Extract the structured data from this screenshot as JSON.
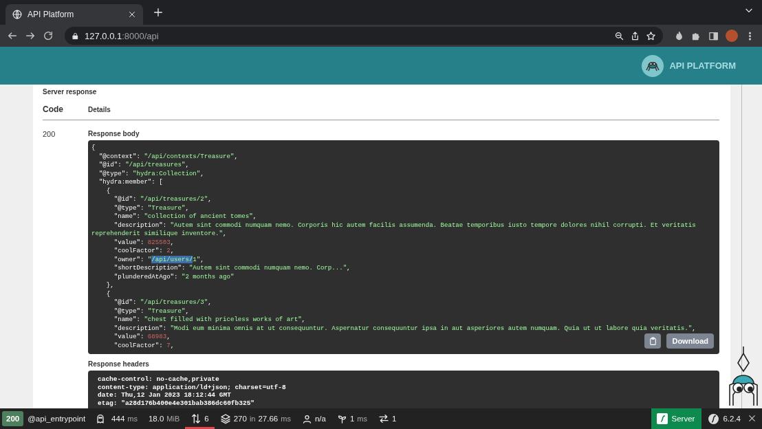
{
  "browser": {
    "tab_title": "API Platform",
    "url_host": "127.0.0.1",
    "url_path": ":8000/api"
  },
  "header": {
    "logo_text": "API PLATFORM"
  },
  "server_response": {
    "title": "Server response",
    "columns": [
      "Code",
      "Details"
    ],
    "code": "200",
    "body_label": "Response body",
    "body_lines": [
      [
        {
          "kind": "plain",
          "text": "{"
        }
      ],
      [
        {
          "kind": "key",
          "text": "  \"@context\": "
        },
        {
          "kind": "str",
          "text": "\"/api/contexts/Treasure\""
        },
        {
          "kind": "plain",
          "text": ","
        }
      ],
      [
        {
          "kind": "key",
          "text": "  \"@id\": "
        },
        {
          "kind": "str",
          "text": "\"/api/treasures\""
        },
        {
          "kind": "plain",
          "text": ","
        }
      ],
      [
        {
          "kind": "key",
          "text": "  \"@type\": "
        },
        {
          "kind": "str",
          "text": "\"hydra:Collection\""
        },
        {
          "kind": "plain",
          "text": ","
        }
      ],
      [
        {
          "kind": "key",
          "text": "  \"hydra:member\": ["
        }
      ],
      [
        {
          "kind": "plain",
          "text": "    {"
        }
      ],
      [
        {
          "kind": "key",
          "text": "      \"@id\": "
        },
        {
          "kind": "str",
          "text": "\"/api/treasures/2\""
        },
        {
          "kind": "plain",
          "text": ","
        }
      ],
      [
        {
          "kind": "key",
          "text": "      \"@type\": "
        },
        {
          "kind": "str",
          "text": "\"Treasure\""
        },
        {
          "kind": "plain",
          "text": ","
        }
      ],
      [
        {
          "kind": "key",
          "text": "      \"name\": "
        },
        {
          "kind": "str",
          "text": "\"collection of ancient tomes\""
        },
        {
          "kind": "plain",
          "text": ","
        }
      ],
      [
        {
          "kind": "key",
          "text": "      \"description\": "
        },
        {
          "kind": "str",
          "text": "\"Autem sint commodi numquam nemo. Corporis hic autem facilis assumenda. Beatae temporibus iusto tempore dolores nihil corrupti. Et veritatis"
        }
      ],
      [
        {
          "kind": "str",
          "text": "reprehenderit similique inventore.\""
        },
        {
          "kind": "plain",
          "text": ","
        }
      ],
      [
        {
          "kind": "key",
          "text": "      \"value\": "
        },
        {
          "kind": "num",
          "text": "825503"
        },
        {
          "kind": "plain",
          "text": ","
        }
      ],
      [
        {
          "kind": "key",
          "text": "      \"coolFactor\": "
        },
        {
          "kind": "num",
          "text": "2"
        },
        {
          "kind": "plain",
          "text": ","
        }
      ],
      [
        {
          "kind": "key",
          "text": "      \"owner\": "
        },
        {
          "kind": "str",
          "text": "\""
        },
        {
          "kind": "selected",
          "text": "/api/users/"
        },
        {
          "kind": "str",
          "text": "1\""
        },
        {
          "kind": "plain",
          "text": ","
        }
      ],
      [
        {
          "kind": "key",
          "text": "      \"shortDescription\": "
        },
        {
          "kind": "str",
          "text": "\"Autem sint commodi numquam nemo. Corp...\""
        },
        {
          "kind": "plain",
          "text": ","
        }
      ],
      [
        {
          "kind": "key",
          "text": "      \"plunderedAtAgo\": "
        },
        {
          "kind": "str",
          "text": "\"2 months ago\""
        }
      ],
      [
        {
          "kind": "plain",
          "text": "    },"
        }
      ],
      [
        {
          "kind": "plain",
          "text": "    {"
        }
      ],
      [
        {
          "kind": "key",
          "text": "      \"@id\": "
        },
        {
          "kind": "str",
          "text": "\"/api/treasures/3\""
        },
        {
          "kind": "plain",
          "text": ","
        }
      ],
      [
        {
          "kind": "key",
          "text": "      \"@type\": "
        },
        {
          "kind": "str",
          "text": "\"Treasure\""
        },
        {
          "kind": "plain",
          "text": ","
        }
      ],
      [
        {
          "kind": "key",
          "text": "      \"name\": "
        },
        {
          "kind": "str",
          "text": "\"chest filled with priceless works of art\""
        },
        {
          "kind": "plain",
          "text": ","
        }
      ],
      [
        {
          "kind": "key",
          "text": "      \"description\": "
        },
        {
          "kind": "str",
          "text": "\"Modi eum minima omnis at ut consequuntur. Aspernatur consequuntur ipsa in aut asperiores autem numquam. Quia ut ut labore quia veritatis.\""
        },
        {
          "kind": "plain",
          "text": ","
        }
      ],
      [
        {
          "kind": "key",
          "text": "      \"value\": "
        },
        {
          "kind": "num",
          "text": "68983"
        },
        {
          "kind": "plain",
          "text": ","
        }
      ],
      [
        {
          "kind": "key",
          "text": "      \"coolFactor\": "
        },
        {
          "kind": "num",
          "text": "7"
        },
        {
          "kind": "plain",
          "text": ","
        }
      ]
    ],
    "download": "Download",
    "headers_label": "Response headers",
    "header_lines": [
      "cache-control: no-cache,private",
      "content-type: application/ld+json; charset=utf-8",
      "date: Thu,12 Jan 2023 18:12:44 GMT",
      "etag: \"a28d176b400e4e301bab386dc60fb325\""
    ]
  },
  "debug_toolbar": {
    "status": "200",
    "route": "@api_entrypoint",
    "items": [
      {
        "kind": "time",
        "value": "444",
        "unit": "ms"
      },
      {
        "kind": "memory",
        "value": "18.0",
        "unit": "MiB"
      },
      {
        "kind": "requests",
        "value": "6"
      },
      {
        "kind": "database",
        "value": "270",
        "middle": "in",
        "value2": "27.66",
        "unit": "ms"
      },
      {
        "kind": "user",
        "value": "n/a"
      },
      {
        "kind": "twig",
        "value": "1",
        "unit": "ms"
      },
      {
        "kind": "forwards",
        "value": "1"
      }
    ],
    "server": "Server",
    "version": "6.2.4"
  }
}
